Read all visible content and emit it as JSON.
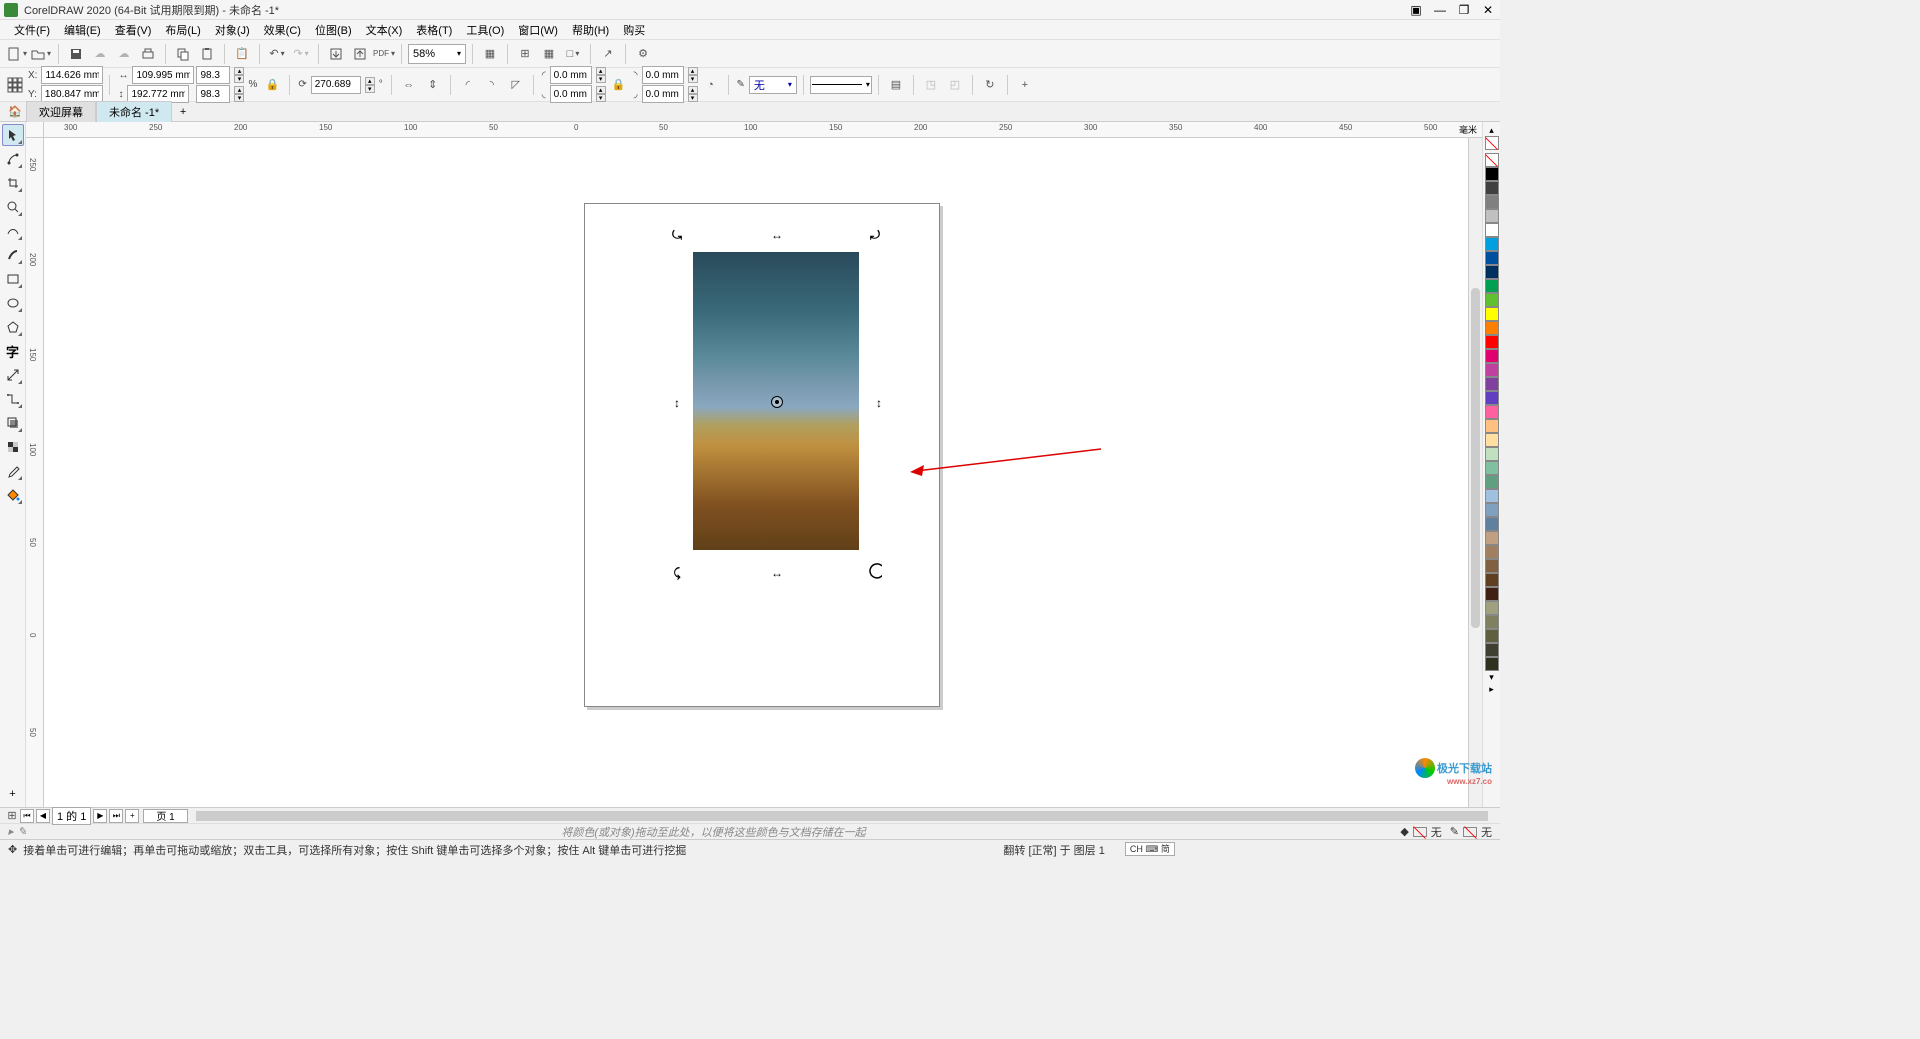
{
  "title": "CorelDRAW 2020 (64-Bit 试用期限到期) - 未命名 -1*",
  "menu": {
    "file": "文件(F)",
    "edit": "编辑(E)",
    "view": "查看(V)",
    "layout": "布局(L)",
    "object": "对象(J)",
    "effects": "效果(C)",
    "bitmaps": "位图(B)",
    "text": "文本(X)",
    "table": "表格(T)",
    "tools": "工具(O)",
    "window": "窗口(W)",
    "help": "帮助(H)",
    "buy": "购买"
  },
  "toolbar1": {
    "zoom": "58%"
  },
  "propbar": {
    "x_label": "X:",
    "y_label": "Y:",
    "x": "114.626 mm",
    "y": "180.847 mm",
    "w": "109.995 mm",
    "h": "192.772 mm",
    "sx": "98.3",
    "sy": "98.3",
    "pct": "%",
    "rot": "270.689",
    "corner1": "0.0 mm",
    "corner2": "0.0 mm",
    "corner3": "0.0 mm",
    "corner4": "0.0 mm",
    "outline_none": "无"
  },
  "tabs": {
    "welcome": "欢迎屏幕",
    "doc": "未命名 -1*"
  },
  "ruler": {
    "unit": "毫米",
    "h_ticks": [
      "300",
      "250",
      "200",
      "150",
      "100",
      "50",
      "0",
      "50",
      "100",
      "150",
      "200",
      "250",
      "300",
      "350",
      "400",
      "450",
      "500"
    ],
    "v_ticks": [
      "250",
      "200",
      "150",
      "100",
      "50",
      "0",
      "50"
    ]
  },
  "pagebar": {
    "counter": "1 的 1",
    "page": "页 1"
  },
  "hintbar": {
    "drag_hint": "将颜色(或对象)拖动至此处，以便将这些颜色与文档存储在一起",
    "none1": "无",
    "none2": "无"
  },
  "statusbar": {
    "hint": "接着单击可进行编辑；再单击可拖动或缩放；双击工具，可选择所有对象；按住 Shift 键单击可选择多个对象；按住 Alt 键单击可进行挖掘",
    "rotation_info": "翻转 [正常] 于 图层 1",
    "ime": "CH ⌨ 简"
  },
  "watermark": {
    "brand": "极光下载站",
    "url": "www.xz7.co"
  },
  "palette_colors": [
    "#000000",
    "#404040",
    "#808080",
    "#c0c0c0",
    "#ffffff",
    "#00a0e0",
    "#0050a0",
    "#003060",
    "#00a050",
    "#60c030",
    "#ffff00",
    "#ff8000",
    "#ff0000",
    "#e00070",
    "#c040a0",
    "#8040a0",
    "#6040c0",
    "#ff60a0",
    "#ffc080",
    "#ffe0a0",
    "#c0e0c0",
    "#80c0a0",
    "#60a080",
    "#a0c0e0",
    "#80a0c0",
    "#6080a0",
    "#c0a080",
    "#a08060",
    "#806040",
    "#604020",
    "#402010",
    "#a0a080",
    "#808060",
    "#606040",
    "#404030",
    "#303020"
  ]
}
